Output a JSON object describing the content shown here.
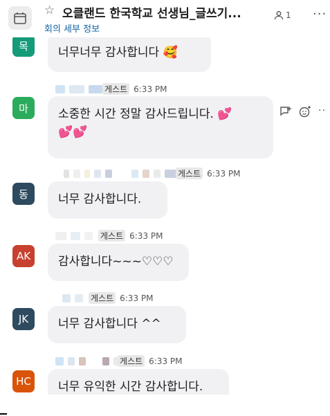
{
  "header": {
    "title": "오클랜드 한국학교 선생님_글쓰기...",
    "subtitle": "회의 세부 정보",
    "member_count": "1"
  },
  "messages": [
    {
      "avatar": "목",
      "color": "#159b78",
      "text": "너무너무 감사합니다 🥰",
      "guest": "",
      "time": ""
    },
    {
      "avatar": "마",
      "color": "#2bab5c",
      "text": "소중한 시간 정말 감사드립니다. 💕",
      "text2": "💕💕",
      "guest": "게스트",
      "time": "6:33 PM"
    },
    {
      "avatar": "동",
      "color": "#2e4a5f",
      "text": "너무 감사합니다.",
      "guest": "게스트",
      "time": "6:33 PM"
    },
    {
      "avatar": "AK",
      "color": "#c8402e",
      "text": "감사합니다~~~♡♡♡",
      "guest": "게스트",
      "time": "6:33 PM"
    },
    {
      "avatar": "JK",
      "color": "#2e4a5f",
      "text": "너무 감사합니다 ^^",
      "guest": "게스트",
      "time": "6:33 PM"
    },
    {
      "avatar": "HC",
      "color": "#d9540a",
      "text": "너무 유익한 시간 감사합니다.",
      "guest": "게스트",
      "time": "6:33 PM"
    }
  ]
}
